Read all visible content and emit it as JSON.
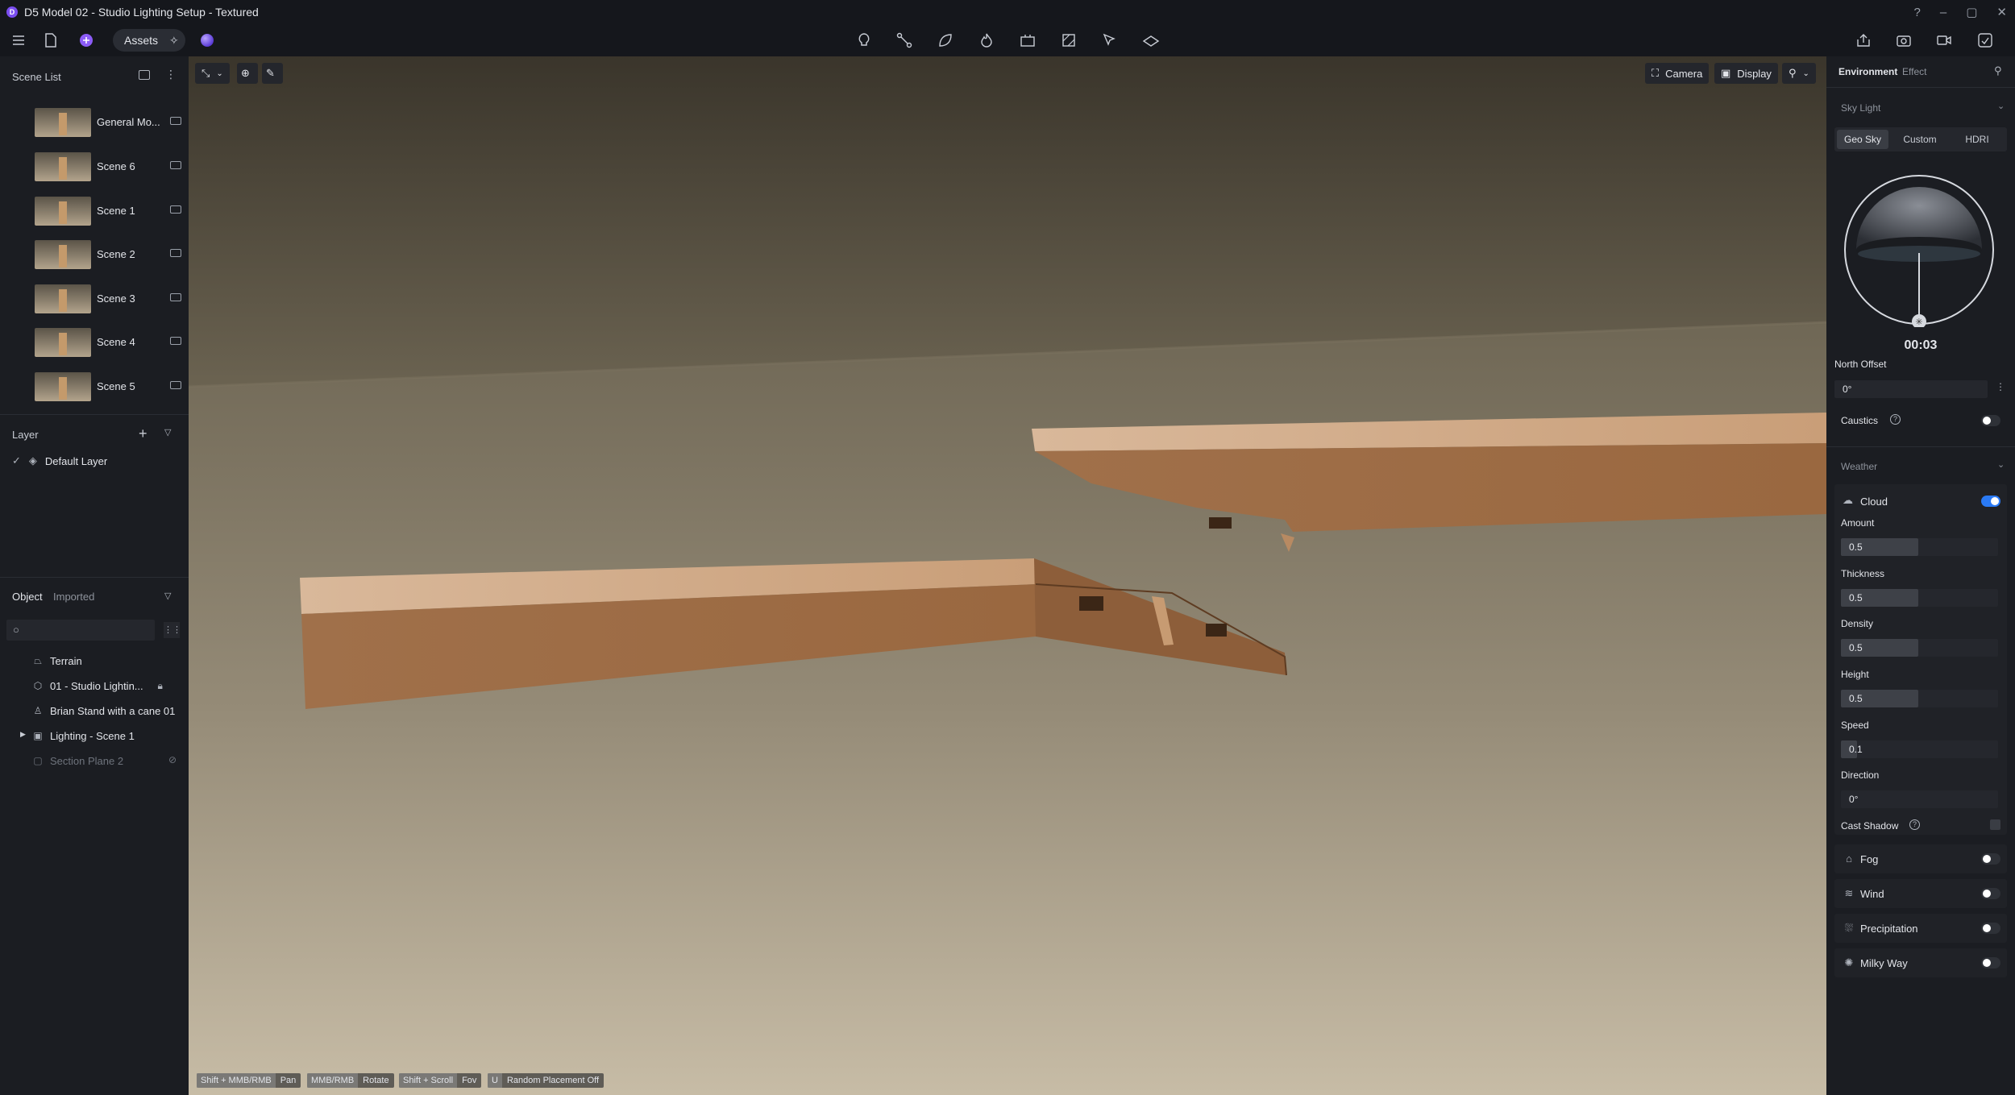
{
  "window": {
    "title": "D5 Model 02 - Studio Lighting Setup - Textured",
    "controls": [
      "?",
      "–",
      "▢",
      "✕"
    ]
  },
  "toolbar": {
    "assets_label": "Assets"
  },
  "left_panel": {
    "scene_list_title": "Scene List",
    "scenes": [
      {
        "name": "General Mo..."
      },
      {
        "name": "Scene 6"
      },
      {
        "name": "Scene 1"
      },
      {
        "name": "Scene 2"
      },
      {
        "name": "Scene 3"
      },
      {
        "name": "Scene 4"
      },
      {
        "name": "Scene 5"
      }
    ],
    "layer_title": "Layer",
    "layers": [
      {
        "name": "Default Layer"
      }
    ],
    "tabs": {
      "object": "Object",
      "imported": "Imported"
    },
    "search_placeholder": "",
    "objects": [
      {
        "name": "Terrain"
      },
      {
        "name": "01 - Studio Lightin..."
      },
      {
        "name": "Brian Stand with a cane 01"
      },
      {
        "name": "Lighting - Scene 1"
      },
      {
        "name": "Section Plane 2"
      }
    ]
  },
  "viewport": {
    "camera_label": "Camera",
    "display_label": "Display",
    "hints": [
      {
        "key": "Shift + MMB/RMB",
        "action": "Pan"
      },
      {
        "key": "MMB/RMB",
        "action": "Rotate"
      },
      {
        "key": "Shift + Scroll",
        "action": "Fov"
      },
      {
        "key": "U",
        "action": "Random Placement Off"
      }
    ]
  },
  "right_panel": {
    "tabs": {
      "environment": "Environment",
      "effect": "Effect"
    },
    "sky_light_title": "Sky Light",
    "sky_modes": [
      "Geo Sky",
      "Custom",
      "HDRI"
    ],
    "time": "00:03",
    "north_offset_label": "North Offset",
    "north_offset_value": "0°",
    "caustics_label": "Caustics",
    "weather_title": "Weather",
    "cloud_label": "Cloud",
    "amount_label": "Amount",
    "amount_value": "0.5",
    "thickness_label": "Thickness",
    "thickness_value": "0.5",
    "density_label": "Density",
    "density_value": "0.5",
    "height_label": "Height",
    "height_value": "0.5",
    "speed_label": "Speed",
    "speed_value": "0.1",
    "direction_label": "Direction",
    "direction_value": "0°",
    "cast_shadow_label": "Cast Shadow",
    "fog_label": "Fog",
    "wind_label": "Wind",
    "precipitation_label": "Precipitation",
    "milky_way_label": "Milky Way",
    "accent_color": "#2a7af5"
  }
}
